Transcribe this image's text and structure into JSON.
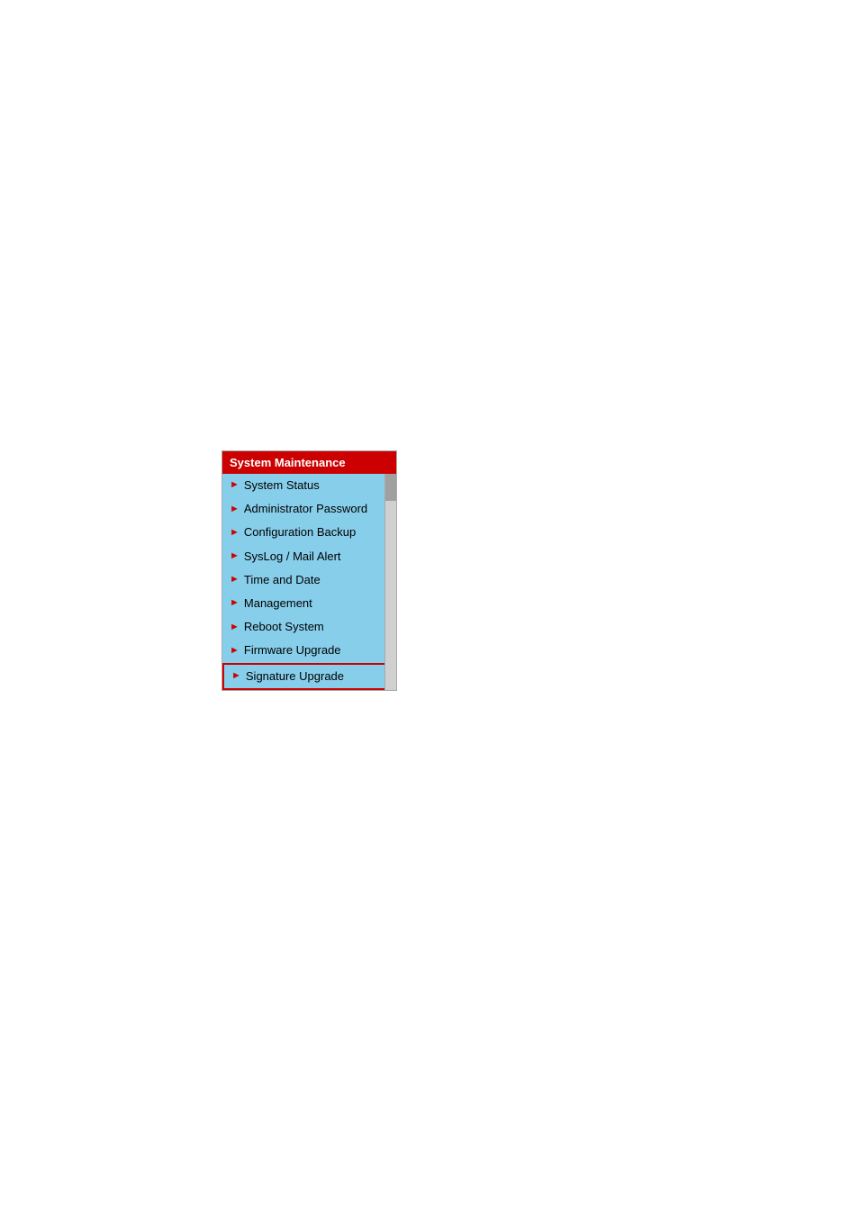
{
  "menu": {
    "header": "System Maintenance",
    "items": [
      {
        "id": "system-status",
        "label": "System Status",
        "active": false
      },
      {
        "id": "administrator-password",
        "label": "Administrator Password",
        "active": false
      },
      {
        "id": "configuration-backup",
        "label": "Configuration Backup",
        "active": false
      },
      {
        "id": "syslog-mail-alert",
        "label": "SysLog / Mail Alert",
        "active": false
      },
      {
        "id": "time-and-date",
        "label": "Time and Date",
        "active": false
      },
      {
        "id": "management",
        "label": "Management",
        "active": false
      },
      {
        "id": "reboot-system",
        "label": "Reboot System",
        "active": false
      },
      {
        "id": "firmware-upgrade",
        "label": "Firmware Upgrade",
        "active": false
      },
      {
        "id": "signature-upgrade",
        "label": "Signature Upgrade",
        "active": true
      }
    ],
    "colors": {
      "header_bg": "#cc0000",
      "menu_bg": "#87ceeb",
      "arrow_color": "#cc0000",
      "active_border": "#cc0000"
    }
  }
}
